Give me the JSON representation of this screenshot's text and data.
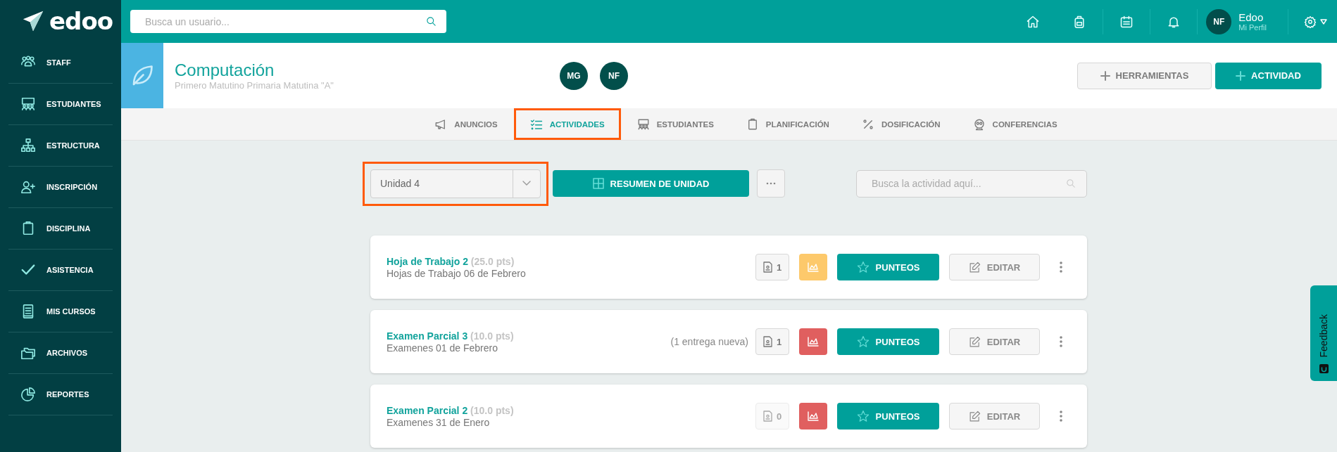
{
  "sidebar": {
    "logo": "edoo",
    "items": [
      {
        "label": "STAFF",
        "kind": "staff"
      },
      {
        "label": "ESTUDIANTES",
        "kind": "students"
      },
      {
        "label": "ESTRUCTURA",
        "kind": "structure"
      },
      {
        "label": "INSCRIPCIÓN",
        "kind": "enroll"
      },
      {
        "label": "DISCIPLINA",
        "kind": "discipline"
      },
      {
        "label": "ASISTENCIA",
        "kind": "attendance"
      },
      {
        "label": "MIS CURSOS",
        "kind": "courses"
      },
      {
        "label": "ARCHIVOS",
        "kind": "files"
      },
      {
        "label": "REPORTES",
        "kind": "reports"
      }
    ]
  },
  "top_bar": {
    "search": {
      "placeholder": "Busca un usuario..."
    },
    "user": {
      "initials": "NF",
      "name": "Edoo",
      "link": "Mi Perfil"
    }
  },
  "course": {
    "title": "Computación",
    "subtitle": "Primero Matutino Primaria Matutina \"A\"",
    "teachers": [
      "MG",
      "NF"
    ],
    "buttons": [
      {
        "label": "HERRAMIENTAS",
        "kind": "secondary"
      },
      {
        "label": "ACTIVIDAD",
        "kind": "primary"
      }
    ]
  },
  "tabs": [
    {
      "label": "ANUNCIOS",
      "kind": "megaphone",
      "selected": false,
      "highlighted": false
    },
    {
      "label": "ACTIVIDADES",
      "kind": "checklist",
      "selected": true,
      "highlighted": true
    },
    {
      "label": "ESTUDIANTES",
      "kind": "students",
      "selected": false,
      "highlighted": false
    },
    {
      "label": "PLANIFICACIÓN",
      "kind": "clipboard",
      "selected": false,
      "highlighted": false
    },
    {
      "label": "DOSIFICACIÓN",
      "kind": "percent",
      "selected": false,
      "highlighted": false
    },
    {
      "label": "CONFERENCIAS",
      "kind": "webcam",
      "selected": false,
      "highlighted": false
    }
  ],
  "toolbar": {
    "unit_selector": {
      "value": "Unidad 4",
      "highlighted": true
    },
    "summary_button": "RESUMEN DE UNIDAD",
    "search": {
      "placeholder": "Busca la actividad aquí..."
    }
  },
  "activities": [
    {
      "title": "Hoja de Trabajo 2",
      "points": "(25.0 pts)",
      "subtitle": "Hojas de Trabajo 06 de Febrero",
      "submissions": {
        "count": "1",
        "disabled": false
      },
      "color": "#fdc96b",
      "grade_button": "PUNTEOS",
      "edit_button": "EDITAR"
    },
    {
      "title": "Examen Parcial 3",
      "points": "(10.0 pts)",
      "subtitle": "Examenes 01 de Febrero",
      "notice": "(1 entrega nueva)",
      "submissions": {
        "count": "1",
        "disabled": false
      },
      "color": "#e05f5f",
      "grade_button": "PUNTEOS",
      "edit_button": "EDITAR"
    },
    {
      "title": "Examen Parcial 2",
      "points": "(10.0 pts)",
      "subtitle": "Examenes 31 de Enero",
      "submissions": {
        "count": "0",
        "disabled": true
      },
      "color": "#e05f5f",
      "grade_button": "PUNTEOS",
      "edit_button": "EDITAR"
    }
  ],
  "feedback_tab": {
    "label": "Feedback"
  }
}
